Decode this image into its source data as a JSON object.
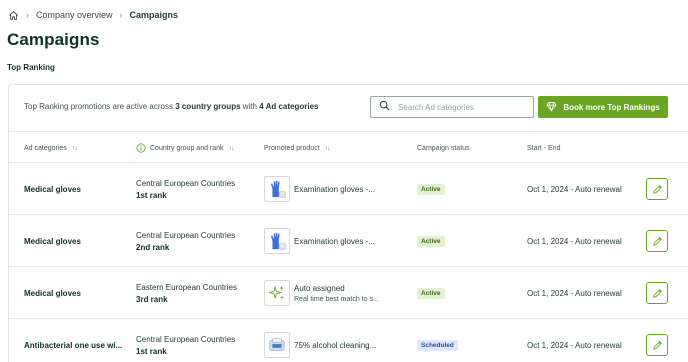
{
  "breadcrumb": {
    "home_icon": "home-icon",
    "items": [
      "Company overview",
      "Campaigns"
    ]
  },
  "page": {
    "title": "Campaigns",
    "section": "Top Ranking"
  },
  "summary": {
    "prefix": "Top Ranking promotions are active across ",
    "groups": "3 country groups",
    "middle": " with ",
    "categories": "4 Ad categories"
  },
  "search": {
    "placeholder": "Search Ad categories",
    "value": ""
  },
  "book_button": {
    "label": "Book more Top Rankings",
    "icon": "diamond-icon"
  },
  "colors": {
    "accent": "#6aa624",
    "title": "#0f3128",
    "active_badge_bg": "#e3f0d3",
    "scheduled_badge_bg": "#dfe8f8"
  },
  "table": {
    "headers": [
      "Ad categories",
      "Country group and rank",
      "Promoted product",
      "Campaign status",
      "Start - End"
    ],
    "sort_glyph": "↑↓",
    "rows": [
      {
        "category": "Medical gloves",
        "country_group": "Central European Countries",
        "rank": "1st rank",
        "product": "Examination gloves -...",
        "product_sub": "",
        "product_icon": "gloves-icon",
        "status": "Active",
        "date": "Oct 1, 2024  -  Auto renewal"
      },
      {
        "category": "Medical gloves",
        "country_group": "Central European Countries",
        "rank": "2nd rank",
        "product": "Examination gloves -...",
        "product_sub": "",
        "product_icon": "gloves-icon",
        "status": "Active",
        "date": "Oct 1, 2024  -  Auto renewal"
      },
      {
        "category": "Medical gloves",
        "country_group": "Eastern European Countries",
        "rank": "3rd rank",
        "product": "Auto assigned",
        "product_sub": "Real time best match to s...",
        "product_icon": "sparkle-icon",
        "status": "Active",
        "date": "Oct 1, 2024  -  Auto renewal"
      },
      {
        "category": "Antibacterial one use wi...",
        "country_group": "Central European Countries",
        "rank": "1st rank",
        "product": "75% alcohol cleaning...",
        "product_sub": "",
        "product_icon": "wipes-icon",
        "status": "Scheduled",
        "date": "Oct 1, 2024  -  Auto renewal"
      }
    ]
  }
}
